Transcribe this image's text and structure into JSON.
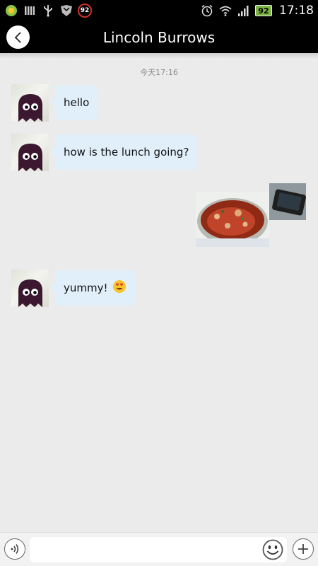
{
  "status_bar": {
    "notification_count": "92",
    "battery_level": "92",
    "time": "17:18",
    "icons": [
      "android-icon",
      "signal-bars-icon",
      "usb-icon",
      "shield-icon",
      "notification-count-icon",
      "alarm-icon",
      "wifi-icon",
      "cell-signal-icon",
      "battery-icon"
    ]
  },
  "header": {
    "title": "Lincoln Burrows",
    "back_icon": "chevron-left-icon",
    "background": "#000000"
  },
  "chat": {
    "timestamp": "今天17:16",
    "bubble_color": "#e1effa",
    "messages": [
      {
        "sender": "contact",
        "type": "text",
        "text": "hello"
      },
      {
        "sender": "contact",
        "type": "text",
        "text": "how is the lunch going?"
      },
      {
        "sender": "self",
        "type": "image",
        "subject": "food-photo"
      },
      {
        "sender": "contact",
        "type": "text",
        "text": "yummy!",
        "emoji": "heart-eyes-emoji"
      }
    ]
  },
  "input_bar": {
    "value": "",
    "placeholder": "",
    "voice_icon": "voice-wave-icon",
    "emoji_icon": "smiley-icon",
    "add_icon": "plus-icon"
  }
}
